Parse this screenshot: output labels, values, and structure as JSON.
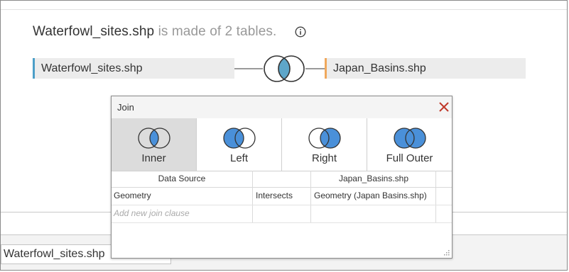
{
  "header": {
    "source_name": "Waterfowl_sites.shp",
    "source_suffix": " is made of 2 tables."
  },
  "tables": {
    "left": "Waterfowl_sites.shp",
    "right": "Japan_Basins.shp",
    "left_color": "#4c9fc8",
    "right_color": "#f0a85c"
  },
  "join_dialog": {
    "title": "Join",
    "join_types": [
      {
        "label": "Inner",
        "selected": true
      },
      {
        "label": "Left",
        "selected": false
      },
      {
        "label": "Right",
        "selected": false
      },
      {
        "label": "Full Outer",
        "selected": false
      }
    ],
    "columns": {
      "left": "Data Source",
      "right": "Japan_Basins.shp"
    },
    "clauses": [
      {
        "left": "Geometry",
        "operator": "Intersects",
        "right": "Geometry (Japan Basins.shp)"
      }
    ],
    "add_clause_placeholder": "Add new join clause",
    "accent": "#4a90d9"
  },
  "bottom_tab": {
    "label": "Waterfowl_sites.shp"
  }
}
